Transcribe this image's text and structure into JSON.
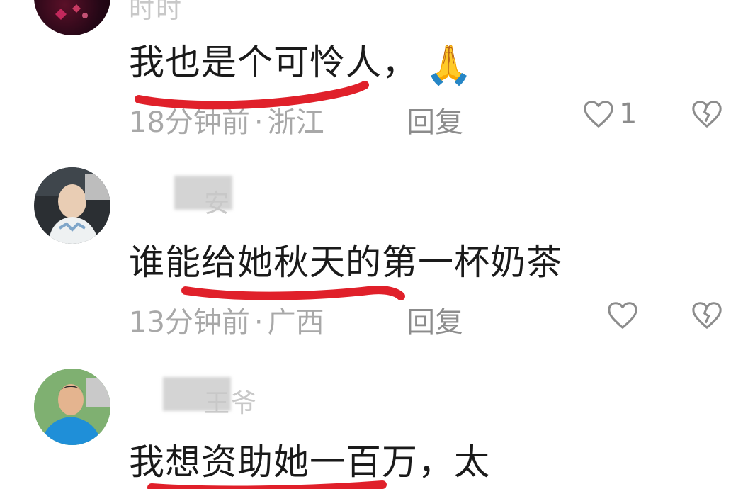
{
  "accent_underline_color": "#e0202a",
  "comments": [
    {
      "username": "时时",
      "content": "我也是个可怜人，",
      "emoji": "🙏",
      "time": "18分钟前",
      "location": "浙江",
      "reply": "回复",
      "like_count": "1"
    },
    {
      "username": "安",
      "content": "谁能给她秋天的第一杯奶茶",
      "time": "13分钟前",
      "location": "广西",
      "reply": "回复",
      "like_count": ""
    },
    {
      "username": "王爷",
      "content": "我想资助她一百万，太",
      "time": "",
      "location": "",
      "reply": "",
      "like_count": ""
    }
  ],
  "icons": {
    "like": "heart-outline-icon",
    "dislike": "broken-heart-icon"
  }
}
